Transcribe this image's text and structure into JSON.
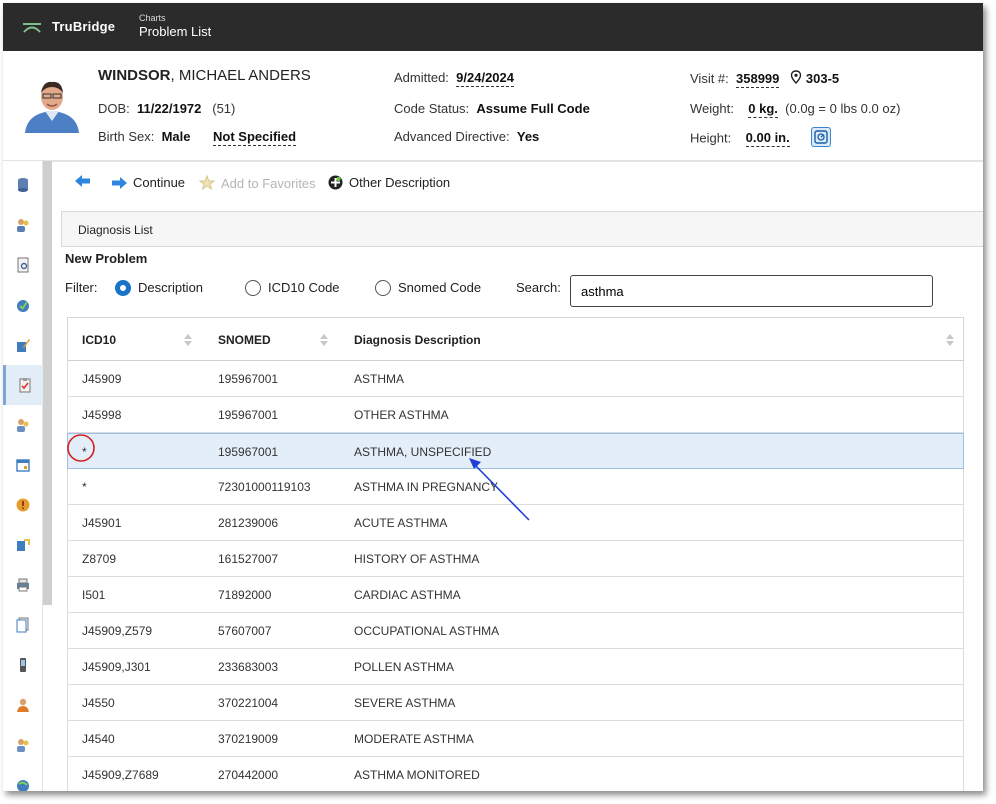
{
  "app": {
    "brand": "TruBridge",
    "breadcrumb_small": "Charts",
    "page_title": "Problem List"
  },
  "patient": {
    "last_name": "WINDSOR",
    "first_name": ", MICHAEL ANDERS",
    "dob_label": "DOB:",
    "dob": "11/22/1972",
    "age": "(51)",
    "birth_sex_label": "Birth Sex:",
    "birth_sex": "Male",
    "gender": "Not Specified",
    "admitted_label": "Admitted:",
    "admitted": "9/24/2024",
    "code_status_label": "Code Status:",
    "code_status": "Assume Full Code",
    "advanced_directive_label": "Advanced Directive:",
    "advanced_directive": "Yes",
    "visit_label": "Visit #:",
    "visit": "358999",
    "room": "303-5",
    "weight_label": "Weight:",
    "weight": "0 kg.",
    "weight_detail": "(0.0g = 0 lbs 0.0 oz)",
    "height_label": "Height:",
    "height": "0.00 in."
  },
  "toolbar": {
    "continue_label": "Continue",
    "favorites_label": "Add to Favorites",
    "other_label": "Other Description"
  },
  "panel": {
    "title": "Diagnosis List",
    "new_problem": "New Problem",
    "filter_label": "Filter:",
    "filters": [
      "Description",
      "ICD10 Code",
      "Snomed Code"
    ],
    "selected_filter": "Description",
    "search_label": "Search:",
    "search_value": "asthma"
  },
  "table": {
    "columns": [
      "ICD10",
      "SNOMED",
      "Diagnosis Description"
    ],
    "rows": [
      [
        "J45909",
        "195967001",
        "ASTHMA"
      ],
      [
        "J45998",
        "195967001",
        "OTHER ASTHMA"
      ],
      [
        "*",
        "195967001",
        "ASTHMA, UNSPECIFIED"
      ],
      [
        "*",
        "72301000119103",
        "ASTHMA IN PREGNANCY"
      ],
      [
        "J45901",
        "281239006",
        "ACUTE ASTHMA"
      ],
      [
        "Z8709",
        "161527007",
        "HISTORY OF ASTHMA"
      ],
      [
        "I501",
        "71892000",
        "CARDIAC ASTHMA"
      ],
      [
        "J45909,Z579",
        "57607007",
        "OCCUPATIONAL ASTHMA"
      ],
      [
        "J45909,J301",
        "233683003",
        "POLLEN ASTHMA"
      ],
      [
        "J4550",
        "370221004",
        "SEVERE ASTHMA"
      ],
      [
        "J4540",
        "370219009",
        "MODERATE ASTHMA"
      ],
      [
        "J45909,Z7689",
        "270442000",
        "ASTHMA MONITORED"
      ]
    ],
    "selected_row": 2
  },
  "colors": {
    "topbar": "#2b2b2b",
    "accent": "#1a73c9",
    "selected_row": "#e4eef8",
    "annotation_red": "#d62020",
    "annotation_blue": "#1f3fd8"
  }
}
